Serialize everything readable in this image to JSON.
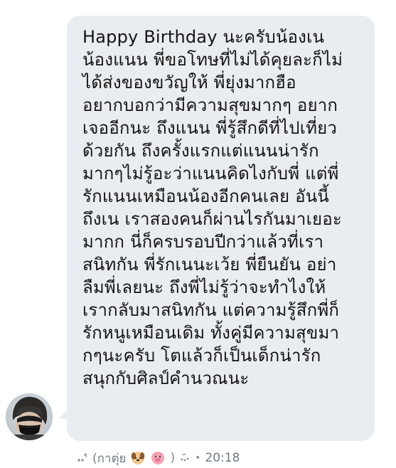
{
  "message": {
    "lines": [
      "Happy Birthday นะครับน้องเน",
      "น้องแนน พี่ขอโทษที่ไม่ได้คุยละก็ไม่",
      "ได้ส่งของขวัญให้ พี่ยุ่งมากฮือ",
      "อยากบอกว่ามีความสุขมากๆ อยาก",
      "เจออีกนะ ถึงแนน พี่รู้สึกดีที่ไปเที่ยว",
      "ด้วยกัน ถึงครั้งแรกแต่แนนน่ารัก",
      "มากๆไม่รู้อะว่าแนนคิดไงกับพี่ แต่พี่",
      "รักแนนเหมือนน้องอีกคนเลย อันนี้",
      "ถึงเน เราสองคนก็ผ่านไรกันมาเยอะ",
      "มากก นี่ก็ครบรอบปีกว่าแล้วที่เรา",
      "สนิทกัน พี่รักเนนะเว้ย พี่ยืนยัน อย่า",
      "ลืมพี่เลยนะ ถึงพี่ไม่รู้ว่าจะทำไงให้",
      "เรากลับมาสนิทกัน แต่ความรู้สึกพี่ก็",
      "รักหนูเหมือนเดิม ทั้งคู่มีความสุขมา",
      "กๆนะครับ โตแล้วก็เป็นเด็กน่ารัก",
      "สนุกกับศิลป์คำนวณนะ"
    ]
  },
  "meta": {
    "sender_name": "(กาตุ่ย",
    "sender_suffix": ")",
    "separator": "•",
    "time": "20:18",
    "icons": [
      "sparkle-icon",
      "dog-emoji",
      "pig-emoji",
      "sparkle-icon"
    ]
  },
  "colors": {
    "bubble": "#e9edf1",
    "text": "#141414",
    "meta": "#7c8791"
  }
}
